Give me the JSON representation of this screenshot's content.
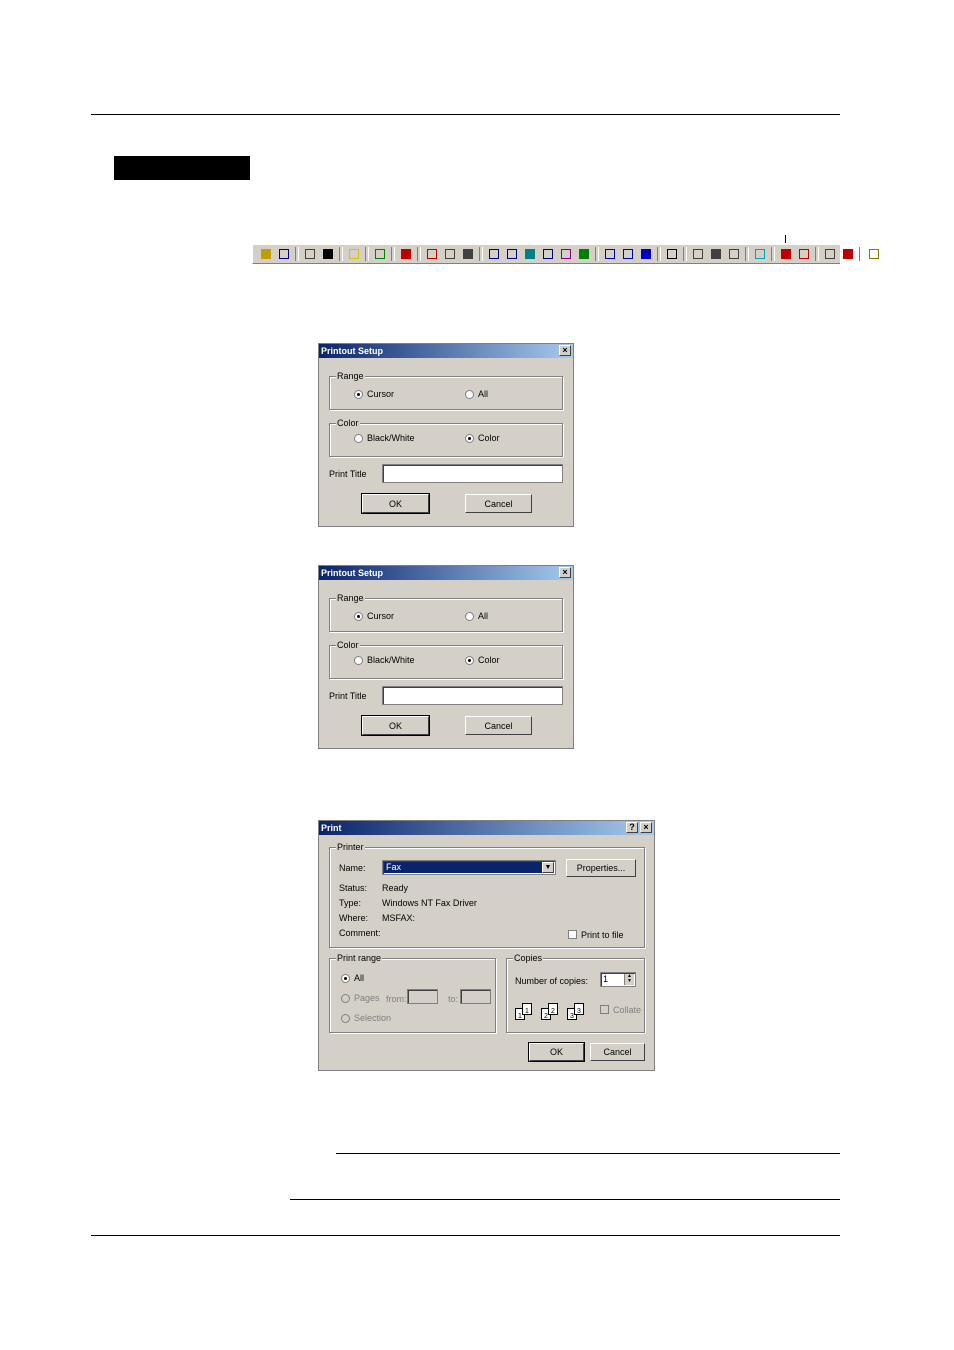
{
  "colors": {
    "title_start": "#0a246a",
    "title_end": "#a6caf0",
    "dialog_bg": "#d4d0c8",
    "select_bg": "#0a246a"
  },
  "toolbar": {
    "icons": [
      "open-folder-icon",
      "save-icon",
      "copy-icon",
      "find-icon",
      "star-icon",
      "export-icon",
      "stop-icon",
      "record-icon",
      "zoom-in-icon",
      "zoom-out-icon",
      "channel-1-icon",
      "channel-2-icon",
      "channel-3-icon",
      "channel-4-icon",
      "channel-5-icon",
      "channel-6-icon",
      "grid-1-icon",
      "grid-2-icon",
      "grid-3-icon",
      "cursor-icon",
      "layout-1-icon",
      "layout-2-icon",
      "layout-3-icon",
      "memo-icon",
      "prev-icon",
      "next-icon",
      "print-icon",
      "alarm-icon",
      "help-icon"
    ]
  },
  "printout_setup_1": {
    "title": "Printout Setup",
    "close": "×",
    "range_label": "Range",
    "range_cursor": "Cursor",
    "range_all": "All",
    "color_label": "Color",
    "color_bw": "Black/White",
    "color_color": "Color",
    "print_title_label": "Print Title",
    "print_title_value": "",
    "ok": "OK",
    "cancel": "Cancel"
  },
  "printout_setup_2": {
    "title": "Printout Setup",
    "close": "×",
    "range_label": "Range",
    "range_cursor": "Cursor",
    "range_all": "All",
    "color_label": "Color",
    "color_bw": "Black/White",
    "color_color": "Color",
    "print_title_label": "Print Title",
    "print_title_value": "",
    "ok": "OK",
    "cancel": "Cancel"
  },
  "print_dialog": {
    "title": "Print",
    "help": "?",
    "close": "×",
    "printer_label": "Printer",
    "name_label": "Name:",
    "name_value": "Fax",
    "properties": "Properties...",
    "status_label": "Status:",
    "status_value": "Ready",
    "type_label": "Type:",
    "type_value": "Windows NT Fax Driver",
    "where_label": "Where:",
    "where_value": "MSFAX:",
    "comment_label": "Comment:",
    "print_to_file": "Print to file",
    "print_range_label": "Print range",
    "range_all": "All",
    "range_pages": "Pages",
    "from_label": "from:",
    "to_label": "to:",
    "range_selection": "Selection",
    "copies_label": "Copies",
    "number_of_copies_label": "Number of copies:",
    "copies_value": "1",
    "collate": "Collate",
    "collate_pages": [
      "1",
      "1",
      "2",
      "2",
      "3",
      "3"
    ],
    "ok": "OK",
    "cancel": "Cancel"
  }
}
